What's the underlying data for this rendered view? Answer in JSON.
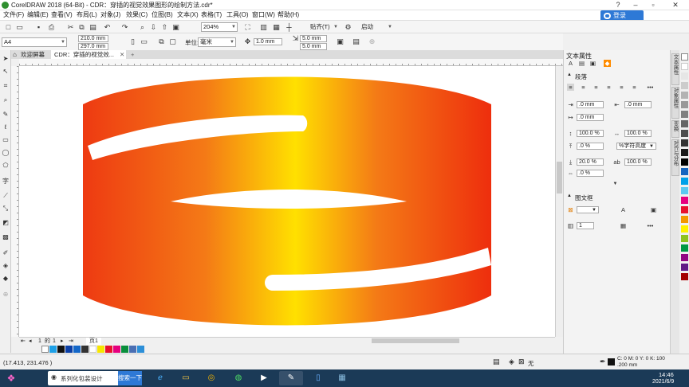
{
  "window": {
    "title": "CorelDRAW 2018 (64-Bit) - CDR：穿插的视觉效果图形的绘制方法.cdr*",
    "cloud_button": "登录"
  },
  "menu": [
    "文件(F)",
    "编辑(E)",
    "查看(V)",
    "布局(L)",
    "对象(J)",
    "效果(C)",
    "位图(B)",
    "文本(X)",
    "表格(T)",
    "工具(O)",
    "窗口(W)",
    "帮助(H)"
  ],
  "standard_toolbar": {
    "zoom": "204%",
    "snap": "贴齐(T)",
    "launch": "启动"
  },
  "property_bar": {
    "page_size": "A4",
    "width": "210.0 mm",
    "height": "297.0 mm",
    "units_label": "单位:",
    "units": "毫米",
    "nudge": "1.0 mm",
    "dup_x": "5.0 mm",
    "dup_y": "5.0 mm"
  },
  "tabs": [
    {
      "label": "欢迎屏幕"
    },
    {
      "label": "CDR：穿插的视觉效..."
    }
  ],
  "page_nav": {
    "counter_current": "1",
    "counter_of": "的",
    "counter_total": "1",
    "page_tab": "页1"
  },
  "docker": {
    "header": "文本属性",
    "paragraph_section": "段落",
    "indent_left": ".0 mm",
    "indent_right": ".0 mm",
    "indent_first": ".0 mm",
    "line_spacing": "100.0 %",
    "char_spacing": "100.0 %",
    "space_before": ".0 %",
    "space_unit": "%字符高度",
    "space_after": "20.0 %",
    "word_spacing": "100.0 %",
    "lang_spacing": ".0 %",
    "frame_section": "图文框",
    "columns": "1"
  },
  "side_tabs": [
    "文本属性",
    "对象属性",
    "变换",
    "对齐与分布"
  ],
  "status": {
    "coords": "(17.413, 231.476 )",
    "fill_label": "无",
    "outline_values": "C: 0 M: 0 Y: 0 K: 100",
    "outline_width": ".200 mm"
  },
  "taskbar": {
    "task_label": "系列化包装设计",
    "search_label": "搜索一下",
    "time": "14:46",
    "date": "2021/6/9"
  },
  "graphic": {
    "gradient_stops": [
      "#ee3a12",
      "#f47a16",
      "#ffe000",
      "#f47a16",
      "#ee2e0d"
    ]
  }
}
